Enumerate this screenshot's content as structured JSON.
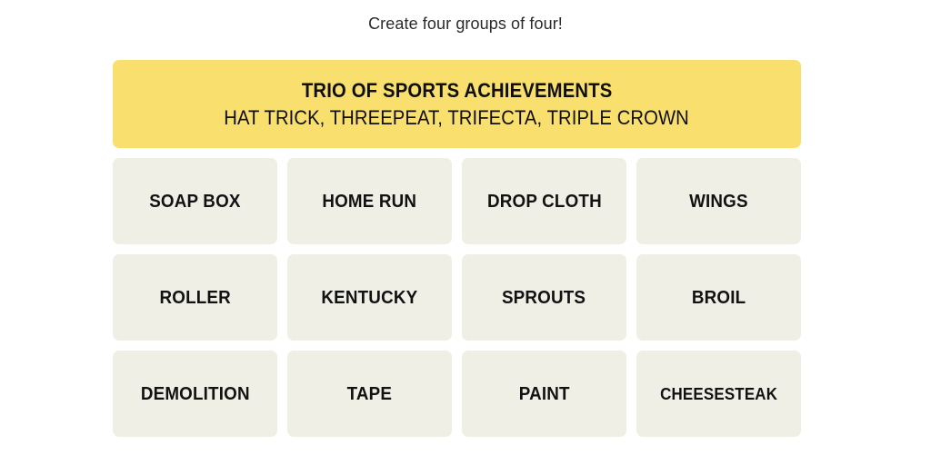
{
  "page": {
    "background_color": "#FFFFFF",
    "instruction": "Create four groups of four!"
  },
  "solved_groups": [
    {
      "title": "TRIO OF SPORTS ACHIEVEMENTS",
      "members_text": "HAT TRICK, THREEPEAT, TRIFECTA, TRIPLE CROWN",
      "members": [
        "HAT TRICK",
        "THREEPEAT",
        "TRIFECTA",
        "TRIPLE CROWN"
      ],
      "color": "#F9DF6D",
      "text_color": "#0F0F0F",
      "difficulty": "yellow"
    }
  ],
  "grid": {
    "tile_color": "#EFEFE6",
    "tile_text_color": "#121212",
    "columns": 4,
    "rows": 3,
    "tiles": [
      {
        "label": "SOAP BOX"
      },
      {
        "label": "HOME RUN"
      },
      {
        "label": "DROP CLOTH"
      },
      {
        "label": "WINGS"
      },
      {
        "label": "ROLLER"
      },
      {
        "label": "KENTUCKY"
      },
      {
        "label": "SPROUTS"
      },
      {
        "label": "BROIL"
      },
      {
        "label": "DEMOLITION"
      },
      {
        "label": "TAPE"
      },
      {
        "label": "PAINT"
      },
      {
        "label": "CHEESESTEAK"
      }
    ]
  }
}
